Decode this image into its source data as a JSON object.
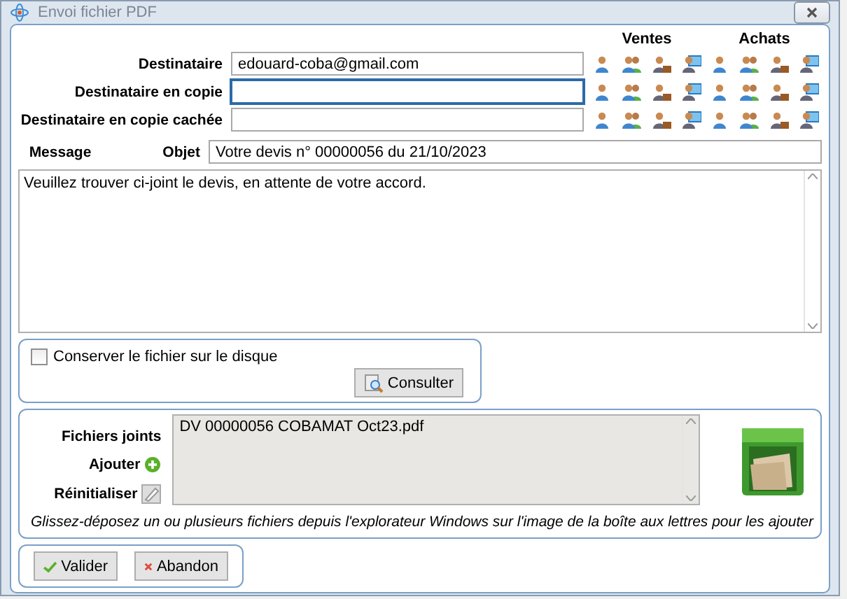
{
  "window": {
    "title": "Envoi fichier PDF"
  },
  "contact_groups": [
    "Ventes",
    "Achats"
  ],
  "recipients": [
    {
      "label": "Destinataire",
      "value": "edouard-coba@gmail.com",
      "focused": false
    },
    {
      "label": "Destinataire en copie",
      "focused": true
    },
    {
      "label": "Destinataire en copie cachée",
      "focused": false
    }
  ],
  "message": {
    "label": "Message",
    "subject_label": "Objet",
    "subject": "Votre devis n° 00000056 du 21/10/2023",
    "body": "Veuillez trouver ci-joint le devis, en attente de votre accord."
  },
  "keep_file": {
    "label": "Conserver le fichier sur le disque",
    "checked": false
  },
  "consult_button": "Consulter",
  "attachments": {
    "label": "Fichiers joints",
    "add_label": "Ajouter",
    "reset_label": "Réinitialiser",
    "files": [
      "DV 00000056 COBAMAT Oct23.pdf"
    ],
    "hint": "Glissez-déposez un ou plusieurs fichiers depuis l'explorateur Windows sur l'image de la boîte aux lettres pour les ajouter"
  },
  "buttons": [
    {
      "kind": "ok",
      "label": "Valider"
    },
    {
      "kind": "cancel",
      "label": "Abandon"
    }
  ]
}
